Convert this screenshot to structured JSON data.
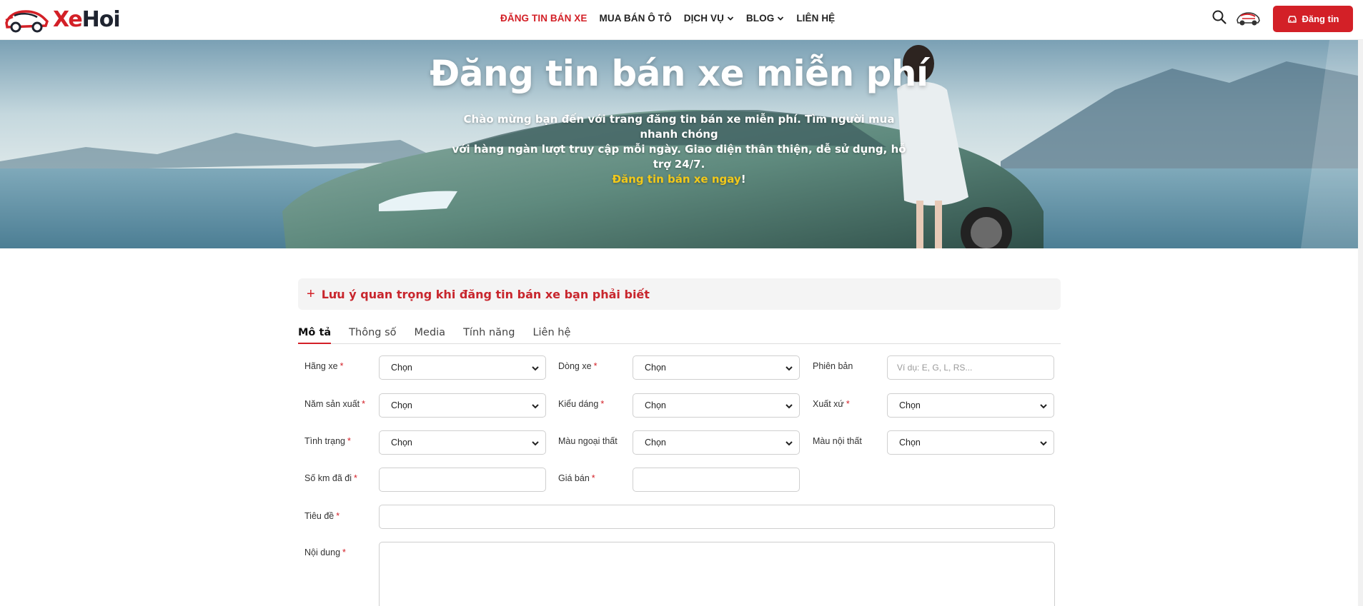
{
  "header": {
    "logo": {
      "part1": "Xe",
      "part2": "Hoi"
    },
    "nav": [
      {
        "label": "ĐĂNG TIN BÁN XE",
        "active": true,
        "dropdown": false
      },
      {
        "label": "MUA BÁN Ô TÔ",
        "active": false,
        "dropdown": false
      },
      {
        "label": "DỊCH VỤ",
        "active": false,
        "dropdown": true
      },
      {
        "label": "BLOG",
        "active": false,
        "dropdown": true
      },
      {
        "label": "LIÊN HỆ",
        "active": false,
        "dropdown": false
      }
    ],
    "post_button": "Đăng tin"
  },
  "hero": {
    "title": "Đăng tin bán xe miễn phí",
    "desc_line1": "Chào mừng bạn đến với trang đăng tin bán xe miễn phí. Tìm người mua nhanh chóng",
    "desc_line2": "với hàng ngàn lượt truy cập mỗi ngày. Giao diện thân thiện, dễ sử dụng, hỗ trợ 24/7.",
    "cta": "Đăng tin bán xe ngay",
    "cta_suffix": "!"
  },
  "notice": {
    "plus": "+",
    "text": "Lưu ý quan trọng khi đăng tin bán xe bạn phải biết"
  },
  "tabs": [
    "Mô tả",
    "Thông số",
    "Media",
    "Tính năng",
    "Liên hệ"
  ],
  "form": {
    "required_mark": "*",
    "hang_xe": {
      "label": "Hãng xe",
      "value": "Chọn"
    },
    "dong_xe": {
      "label": "Dòng xe",
      "value": "Chọn"
    },
    "phien_ban": {
      "label": "Phiên bản",
      "placeholder": "Ví dụ: E, G, L, RS..."
    },
    "nam_san_xuat": {
      "label": "Năm sản xuất",
      "value": "Chọn"
    },
    "kieu_dang": {
      "label": "Kiểu dáng",
      "value": "Chọn"
    },
    "xuat_xu": {
      "label": "Xuất xứ",
      "value": "Chọn"
    },
    "tinh_trang": {
      "label": "Tình trạng",
      "value": "Chọn"
    },
    "mau_ngoai_that": {
      "label": "Màu ngoại thất",
      "value": "Chọn"
    },
    "mau_noi_that": {
      "label": "Màu nội thất",
      "value": "Chọn"
    },
    "so_km": {
      "label": "Số km đã đi",
      "value": ""
    },
    "gia_ban": {
      "label": "Giá bán",
      "value": ""
    },
    "tieu_de": {
      "label": "Tiêu đề",
      "value": ""
    },
    "noi_dung": {
      "label": "Nội dung",
      "value": ""
    }
  },
  "colors": {
    "brand_red": "#d32027",
    "cta_yellow": "#f2c91a",
    "logo_dark": "#1f2430"
  },
  "icons": [
    "car-logo-icon",
    "search-icon",
    "car-avatar-icon",
    "car-icon",
    "chevron-down-icon",
    "plus-icon"
  ]
}
